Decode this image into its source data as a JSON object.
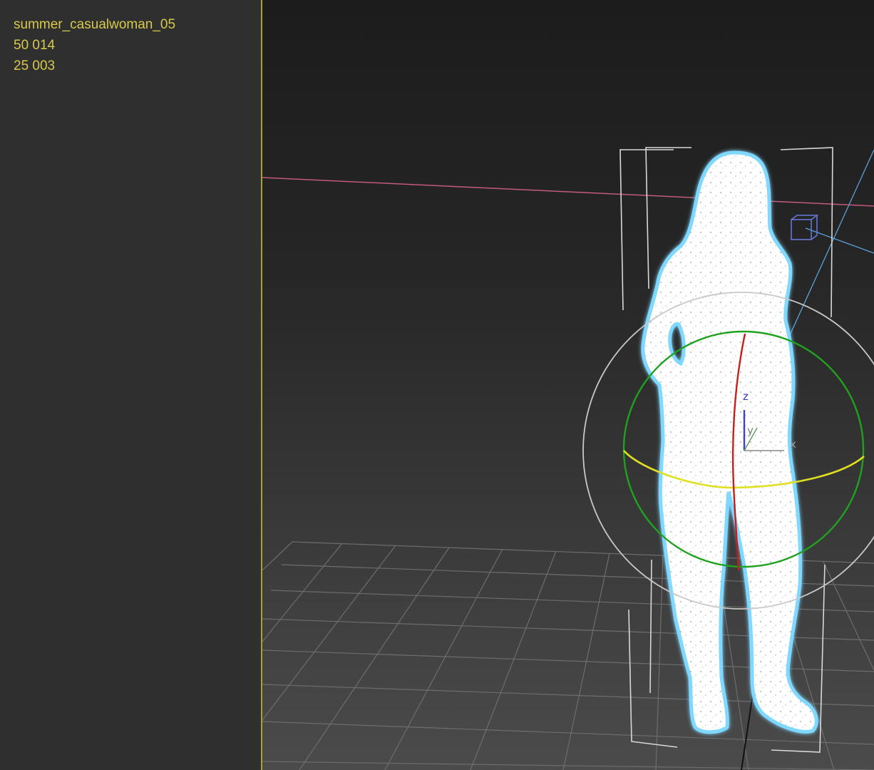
{
  "stats": {
    "object_name": "summer_casualwoman_05",
    "polygons": "50 014",
    "vertices": "25 003"
  },
  "gizmo": {
    "z_label": "z",
    "y_label": "y",
    "x_label": "x"
  },
  "colors": {
    "stats_text": "#d8c94a",
    "viewport_border": "#aaa22f",
    "selection_glow": "#7fd8ff",
    "ring_green": "#1fa21f",
    "ring_yellow": "#e0e020",
    "axis_red": "#c81e1e",
    "horizon_pink": "#c45a7a"
  }
}
